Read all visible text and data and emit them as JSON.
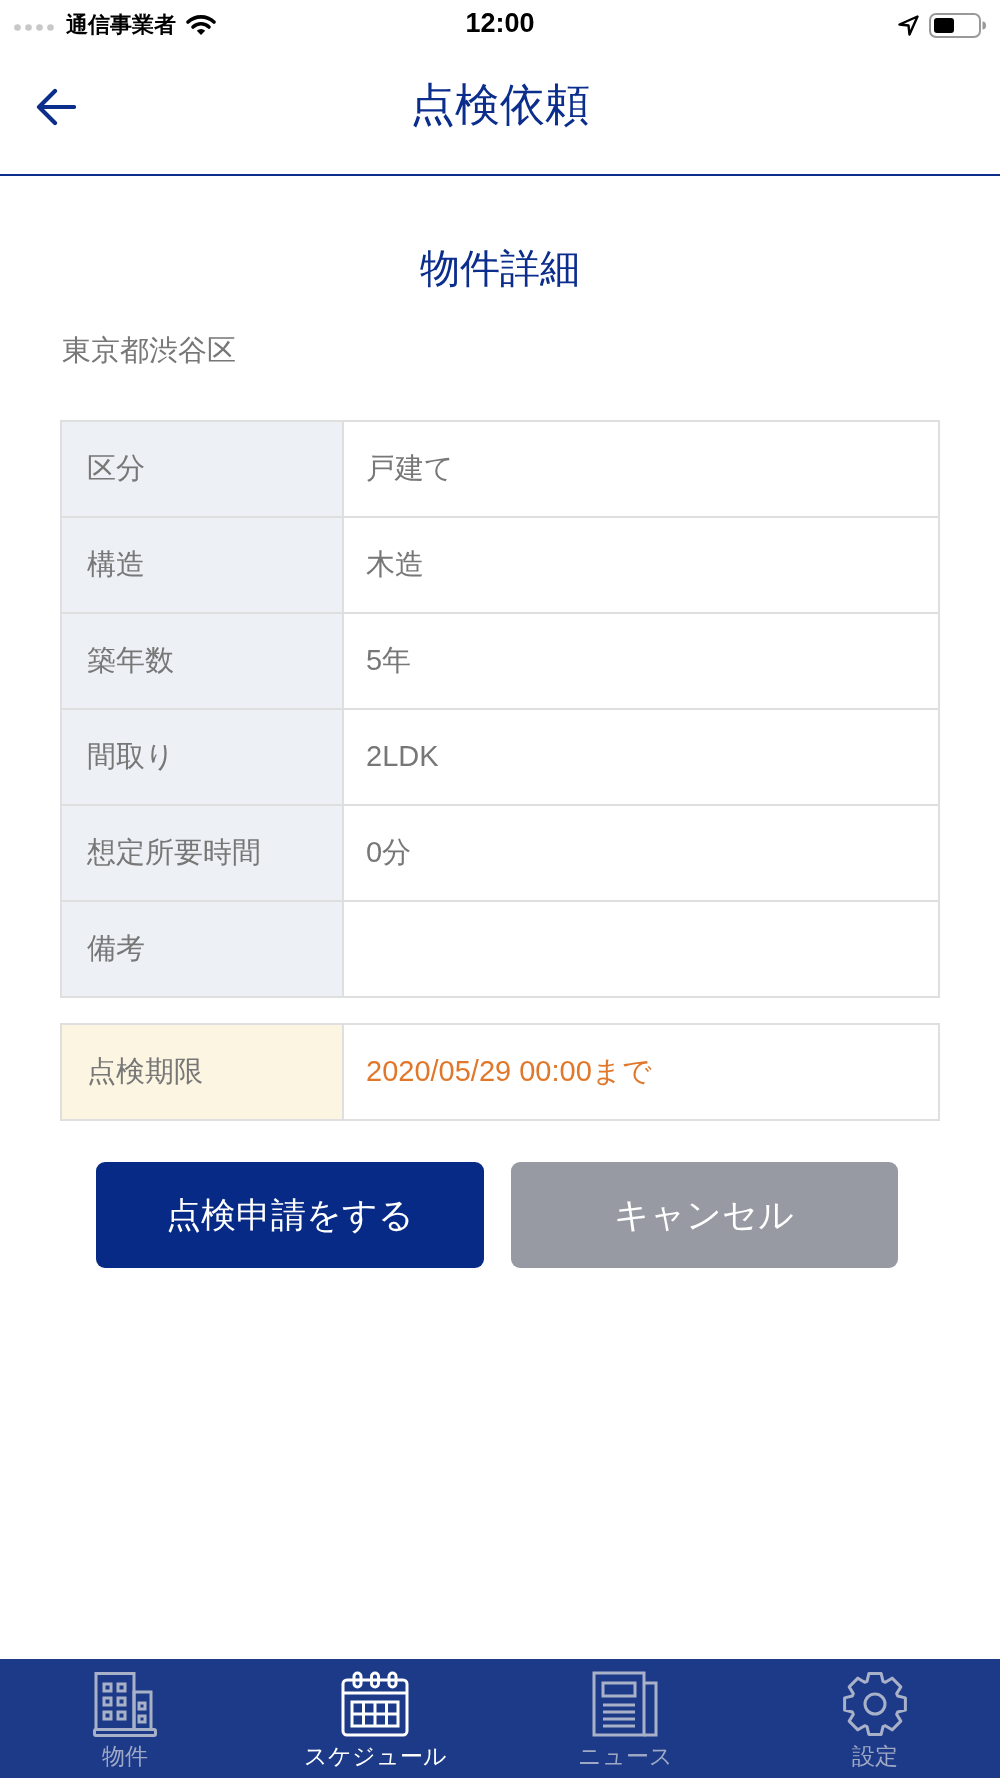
{
  "status_bar": {
    "carrier": "通信事業者",
    "time": "12:00"
  },
  "header": {
    "title": "点検依頼"
  },
  "section_title": "物件詳細",
  "address": "東京都渋谷区",
  "details": [
    {
      "label": "区分",
      "value": "戸建て"
    },
    {
      "label": "構造",
      "value": "木造"
    },
    {
      "label": "築年数",
      "value": "5年"
    },
    {
      "label": "間取り",
      "value": "2LDK"
    },
    {
      "label": "想定所要時間",
      "value": "0分"
    },
    {
      "label": "備考"
    }
  ],
  "deadline": {
    "label": "点検期限",
    "value": "2020/05/29 00:00まで"
  },
  "buttons": [
    {
      "label": "点検申請をする",
      "kind": "primary"
    },
    {
      "label": "キャンセル",
      "kind": "secondary"
    }
  ],
  "tabs": [
    {
      "label": "物件",
      "selected": false
    },
    {
      "label": "スケジュール",
      "selected": true
    },
    {
      "label": "ニュース",
      "selected": false
    },
    {
      "label": "設定",
      "selected": false
    }
  ]
}
